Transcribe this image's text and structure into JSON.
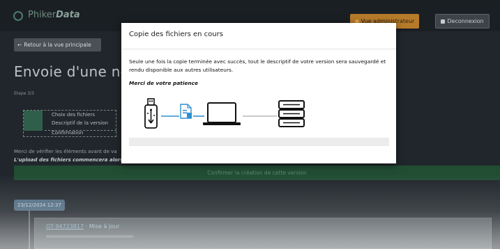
{
  "header": {
    "brand_prefix": "Phiker",
    "brand_suffix": "Data",
    "admin_label": "Vue administrateur",
    "logout_label": "Deconnexion"
  },
  "main": {
    "back_label": "Retour à la vue principale",
    "title": "Envoie d'une nouv",
    "step": "Etape 3/3",
    "steps": [
      "Choix des fichiers",
      "Descriptif de la version",
      "Confirmation"
    ],
    "hint_line1": "Merci de vérifier les éléments avant de va",
    "hint_line2": "L'upload des fichiers commencera alors",
    "confirm_label": "Confirmer la création de cette version"
  },
  "timeline": {
    "date": "23/12/2024 12:37",
    "version_id": "OT-94723817",
    "title_suffix": "· Mise à jour"
  },
  "modal": {
    "title": "Copie des fichiers en cours",
    "text": "Seule une fois la copie terminée avec succès, tout le descriptif de votre version sera sauvegardé et rendu disponible aux autres utilisateurs.",
    "thanks": "Merci de votre patience",
    "progress": 0
  },
  "colors": {
    "accent_green": "#214d33",
    "admin_orange": "#b67b2a",
    "illustration_blue": "#2f8fd0"
  }
}
